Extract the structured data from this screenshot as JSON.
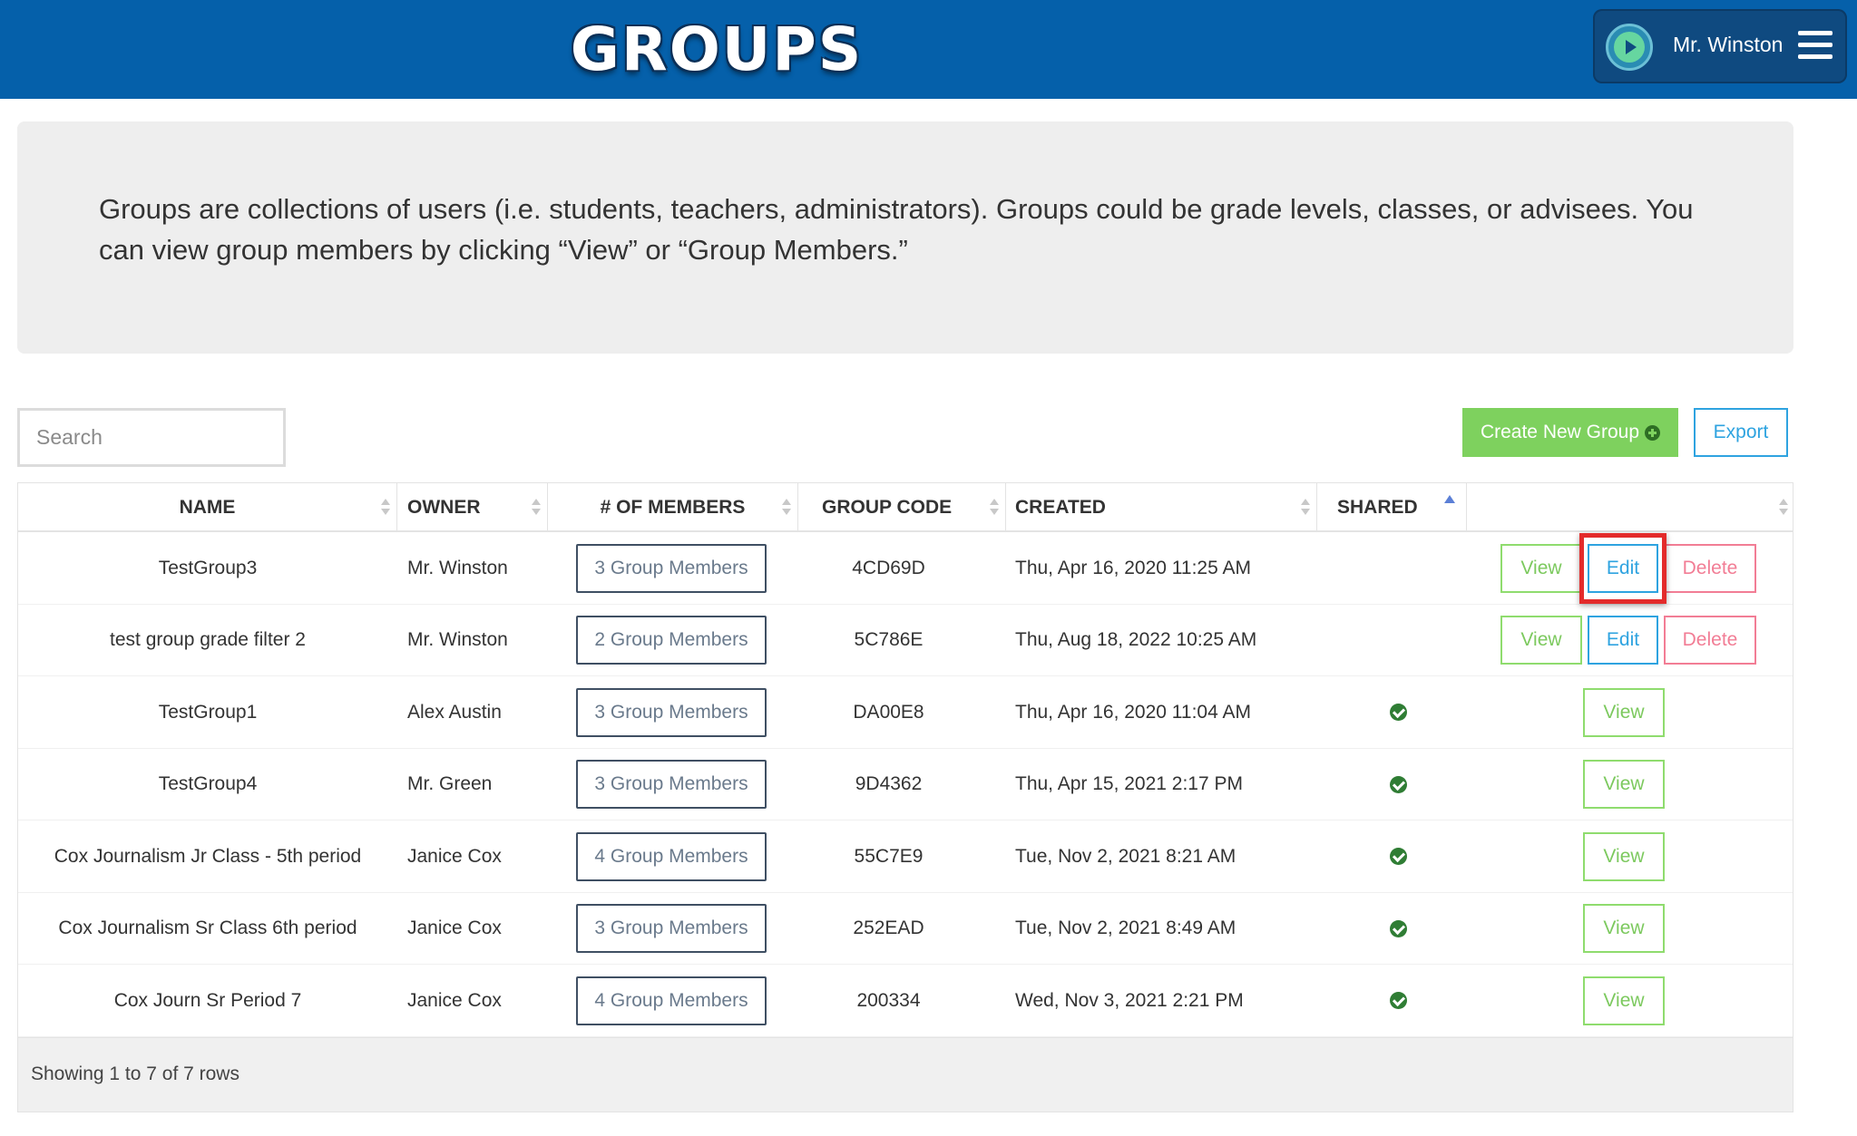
{
  "header": {
    "title": "GROUPS",
    "user_name": "Mr. Winston",
    "colors": {
      "bar": "#0560aa",
      "user_box": "#0f4a80"
    }
  },
  "info": {
    "text": "Groups are collections of users (i.e. students, teachers, administrators). Groups could be grade levels, classes, or advisees. You can view group members by clicking “View” or “Group Members.”"
  },
  "controls": {
    "search_placeholder": "Search",
    "create_label": "Create New Group",
    "export_label": "Export"
  },
  "table": {
    "columns": [
      "NAME",
      "OWNER",
      "# OF MEMBERS",
      "GROUP CODE",
      "CREATED",
      "SHARED",
      ""
    ],
    "rows": [
      {
        "name": "TestGroup3",
        "owner": "Mr. Winston",
        "members": "3 Group Members",
        "code": "4CD69D",
        "created": "Thu, Apr 16, 2020 11:25 AM",
        "shared": false,
        "actions": [
          "View",
          "Edit",
          "Delete"
        ],
        "highlight_edit": true
      },
      {
        "name": "test group grade filter 2",
        "owner": "Mr. Winston",
        "members": "2 Group Members",
        "code": "5C786E",
        "created": "Thu, Aug 18, 2022 10:25 AM",
        "shared": false,
        "actions": [
          "View",
          "Edit",
          "Delete"
        ],
        "highlight_edit": false
      },
      {
        "name": "TestGroup1",
        "owner": "Alex Austin",
        "members": "3 Group Members",
        "code": "DA00E8",
        "created": "Thu, Apr 16, 2020 11:04 AM",
        "shared": true,
        "actions": [
          "View"
        ]
      },
      {
        "name": "TestGroup4",
        "owner": "Mr. Green",
        "members": "3 Group Members",
        "code": "9D4362",
        "created": "Thu, Apr 15, 2021 2:17 PM",
        "shared": true,
        "actions": [
          "View"
        ]
      },
      {
        "name": "Cox Journalism Jr Class - 5th period",
        "owner": "Janice Cox",
        "members": "4 Group Members",
        "code": "55C7E9",
        "created": "Tue, Nov 2, 2021 8:21 AM",
        "shared": true,
        "actions": [
          "View"
        ]
      },
      {
        "name": "Cox Journalism Sr Class 6th period",
        "owner": "Janice Cox",
        "members": "3 Group Members",
        "code": "252EAD",
        "created": "Tue, Nov 2, 2021 8:49 AM",
        "shared": true,
        "actions": [
          "View"
        ]
      },
      {
        "name": "Cox Journ Sr Period 7",
        "owner": "Janice Cox",
        "members": "4 Group Members",
        "code": "200334",
        "created": "Wed, Nov 3, 2021 2:21 PM",
        "shared": true,
        "actions": [
          "View"
        ]
      }
    ],
    "footer": "Showing 1 to 7 of 7 rows"
  }
}
